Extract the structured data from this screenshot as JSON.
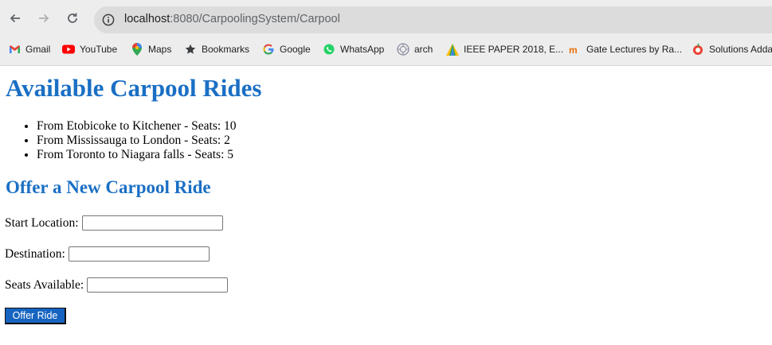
{
  "browser": {
    "url_host": "localhost",
    "url_path": ":8080/CarpoolingSystem/Carpool",
    "bookmarks": [
      {
        "label": "Gmail",
        "icon": "gmail-icon"
      },
      {
        "label": "YouTube",
        "icon": "youtube-icon"
      },
      {
        "label": "Maps",
        "icon": "maps-icon"
      },
      {
        "label": "Bookmarks",
        "icon": "star-icon"
      },
      {
        "label": "Google",
        "icon": "google-icon"
      },
      {
        "label": "WhatsApp",
        "icon": "whatsapp-icon"
      },
      {
        "label": "arch",
        "icon": "arch-icon"
      },
      {
        "label": "IEEE PAPER 2018, E...",
        "icon": "ieee-icon"
      },
      {
        "label": "Gate Lectures by Ra...",
        "icon": "gate-icon"
      },
      {
        "label": "Solutions Adda",
        "icon": "solutions-icon"
      }
    ]
  },
  "page": {
    "title": "Available Carpool Rides",
    "rides": [
      "From Etobicoke to Kitchener - Seats: 10",
      "From Mississauga to London - Seats: 2",
      "From Toronto to Niagara falls - Seats: 5"
    ],
    "form_title": "Offer a New Carpool Ride",
    "start_label": "Start Location:",
    "start_value": "",
    "destination_label": "Destination:",
    "destination_value": "",
    "seats_label": "Seats Available:",
    "seats_value": "",
    "submit_label": "Offer Ride"
  },
  "colors": {
    "heading": "#1a6fc4",
    "button": "#1664c0"
  }
}
